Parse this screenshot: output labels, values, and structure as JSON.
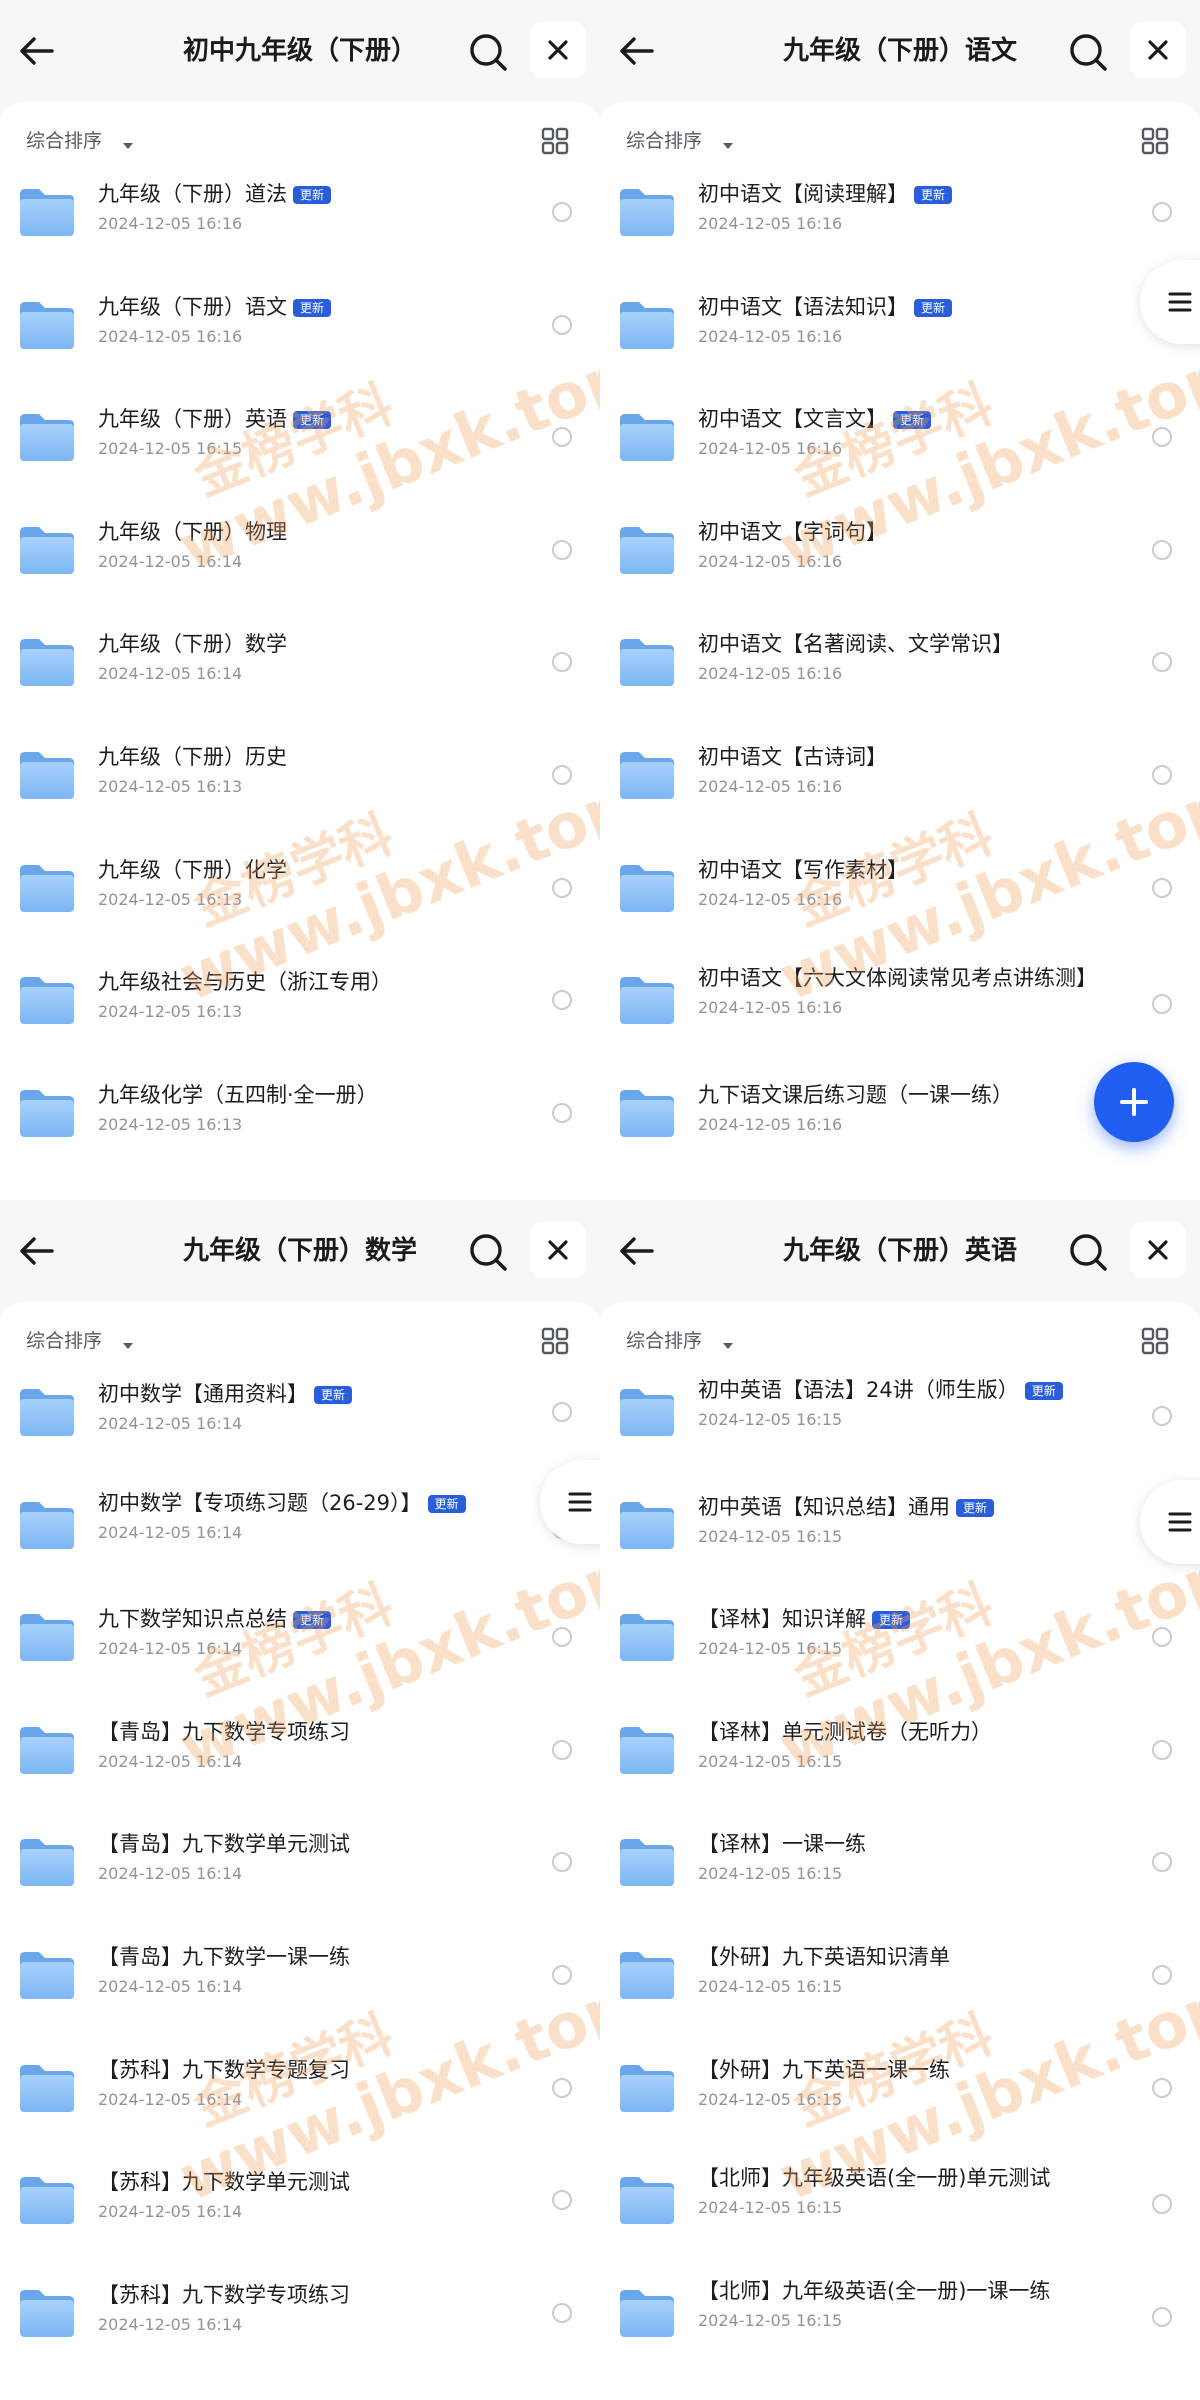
{
  "colors": {
    "accent": "#2a5ed9",
    "fab": "#1f5ef0",
    "folder": "#7db6f3"
  },
  "icons": {
    "back": "arrow-left-icon",
    "search": "search-icon",
    "close": "close-icon",
    "sort_arrow": "caret-down-icon",
    "view": "grid-view-icon",
    "folder": "folder-icon",
    "side": "menu-icon",
    "fab": "plus-icon"
  },
  "sort_label": "综合排序",
  "badge_label": "更新",
  "watermark": {
    "cn": "金榜学科",
    "en": "www.jbxk.top"
  },
  "panels": [
    {
      "title": "初中九年级（下册）",
      "items": [
        {
          "name": "九年级（下册）道法",
          "badge": true,
          "date": "2024-12-05 16:16"
        },
        {
          "name": "九年级（下册）语文",
          "badge": true,
          "date": "2024-12-05 16:16"
        },
        {
          "name": "九年级（下册）英语",
          "badge": true,
          "date": "2024-12-05 16:15"
        },
        {
          "name": "九年级（下册）物理",
          "badge": false,
          "date": "2024-12-05 16:14"
        },
        {
          "name": "九年级（下册）数学",
          "badge": false,
          "date": "2024-12-05 16:14"
        },
        {
          "name": "九年级（下册）历史",
          "badge": false,
          "date": "2024-12-05 16:13"
        },
        {
          "name": "九年级（下册）化学",
          "badge": false,
          "date": "2024-12-05 16:13"
        },
        {
          "name": "九年级社会与历史（浙江专用）",
          "badge": false,
          "date": "2024-12-05 16:13"
        },
        {
          "name": "九年级化学（五四制·全一册）",
          "badge": false,
          "date": "2024-12-05 16:13"
        }
      ]
    },
    {
      "title": "九年级（下册）语文",
      "items": [
        {
          "name": "初中语文【阅读理解】",
          "badge": true,
          "date": "2024-12-05 16:16"
        },
        {
          "name": "初中语文【语法知识】",
          "badge": true,
          "date": "2024-12-05 16:16"
        },
        {
          "name": "初中语文【文言文】",
          "badge": true,
          "date": "2024-12-05 16:16"
        },
        {
          "name": "初中语文【字词句】",
          "badge": false,
          "date": "2024-12-05 16:16"
        },
        {
          "name": "初中语文【名著阅读、文学常识】",
          "badge": false,
          "date": "2024-12-05 16:16"
        },
        {
          "name": "初中语文【古诗词】",
          "badge": false,
          "date": "2024-12-05 16:16"
        },
        {
          "name": "初中语文【写作素材】",
          "badge": false,
          "date": "2024-12-05 16:16"
        },
        {
          "name": "初中语文【六大文体阅读常见考点讲练测】",
          "badge": false,
          "date": "2024-12-05 16:16"
        },
        {
          "name": "九下语文课后练习题（一课一练）",
          "badge": false,
          "date": "2024-12-05 16:16"
        }
      ]
    },
    {
      "title": "九年级（下册）数学",
      "items": [
        {
          "name": "初中数学【通用资料】",
          "badge": true,
          "date": "2024-12-05 16:14"
        },
        {
          "name": "初中数学【专项练习题（26-29）】",
          "badge": true,
          "date": "2024-12-05 16:14"
        },
        {
          "name": "九下数学知识点总结",
          "badge": true,
          "date": "2024-12-05 16:14"
        },
        {
          "name": "【青岛】九下数学专项练习",
          "badge": false,
          "date": "2024-12-05 16:14"
        },
        {
          "name": "【青岛】九下数学单元测试",
          "badge": false,
          "date": "2024-12-05 16:14"
        },
        {
          "name": "【青岛】九下数学一课一练",
          "badge": false,
          "date": "2024-12-05 16:14"
        },
        {
          "name": "【苏科】九下数学专题复习",
          "badge": false,
          "date": "2024-12-05 16:14"
        },
        {
          "name": "【苏科】九下数学单元测试",
          "badge": false,
          "date": "2024-12-05 16:14"
        },
        {
          "name": "【苏科】九下数学专项练习",
          "badge": false,
          "date": "2024-12-05 16:14"
        }
      ]
    },
    {
      "title": "九年级（下册）英语",
      "items": [
        {
          "name": "初中英语【语法】24讲（师生版）",
          "badge": true,
          "date": "2024-12-05 16:15"
        },
        {
          "name": "初中英语【知识总结】通用",
          "badge": true,
          "date": "2024-12-05 16:15"
        },
        {
          "name": "【译林】知识详解",
          "badge": true,
          "date": "2024-12-05 16:15"
        },
        {
          "name": "【译林】单元测试卷（无听力）",
          "badge": false,
          "date": "2024-12-05 16:15"
        },
        {
          "name": "【译林】一课一练",
          "badge": false,
          "date": "2024-12-05 16:15"
        },
        {
          "name": "【外研】九下英语知识清单",
          "badge": false,
          "date": "2024-12-05 16:15"
        },
        {
          "name": "【外研】九下英语一课一练",
          "badge": false,
          "date": "2024-12-05 16:15"
        },
        {
          "name": "【北师】九年级英语(全一册)单元测试",
          "badge": false,
          "date": "2024-12-05 16:15"
        },
        {
          "name": "【北师】九年级英语(全一册)一课一练",
          "badge": false,
          "date": "2024-12-05 16:15"
        }
      ]
    }
  ]
}
